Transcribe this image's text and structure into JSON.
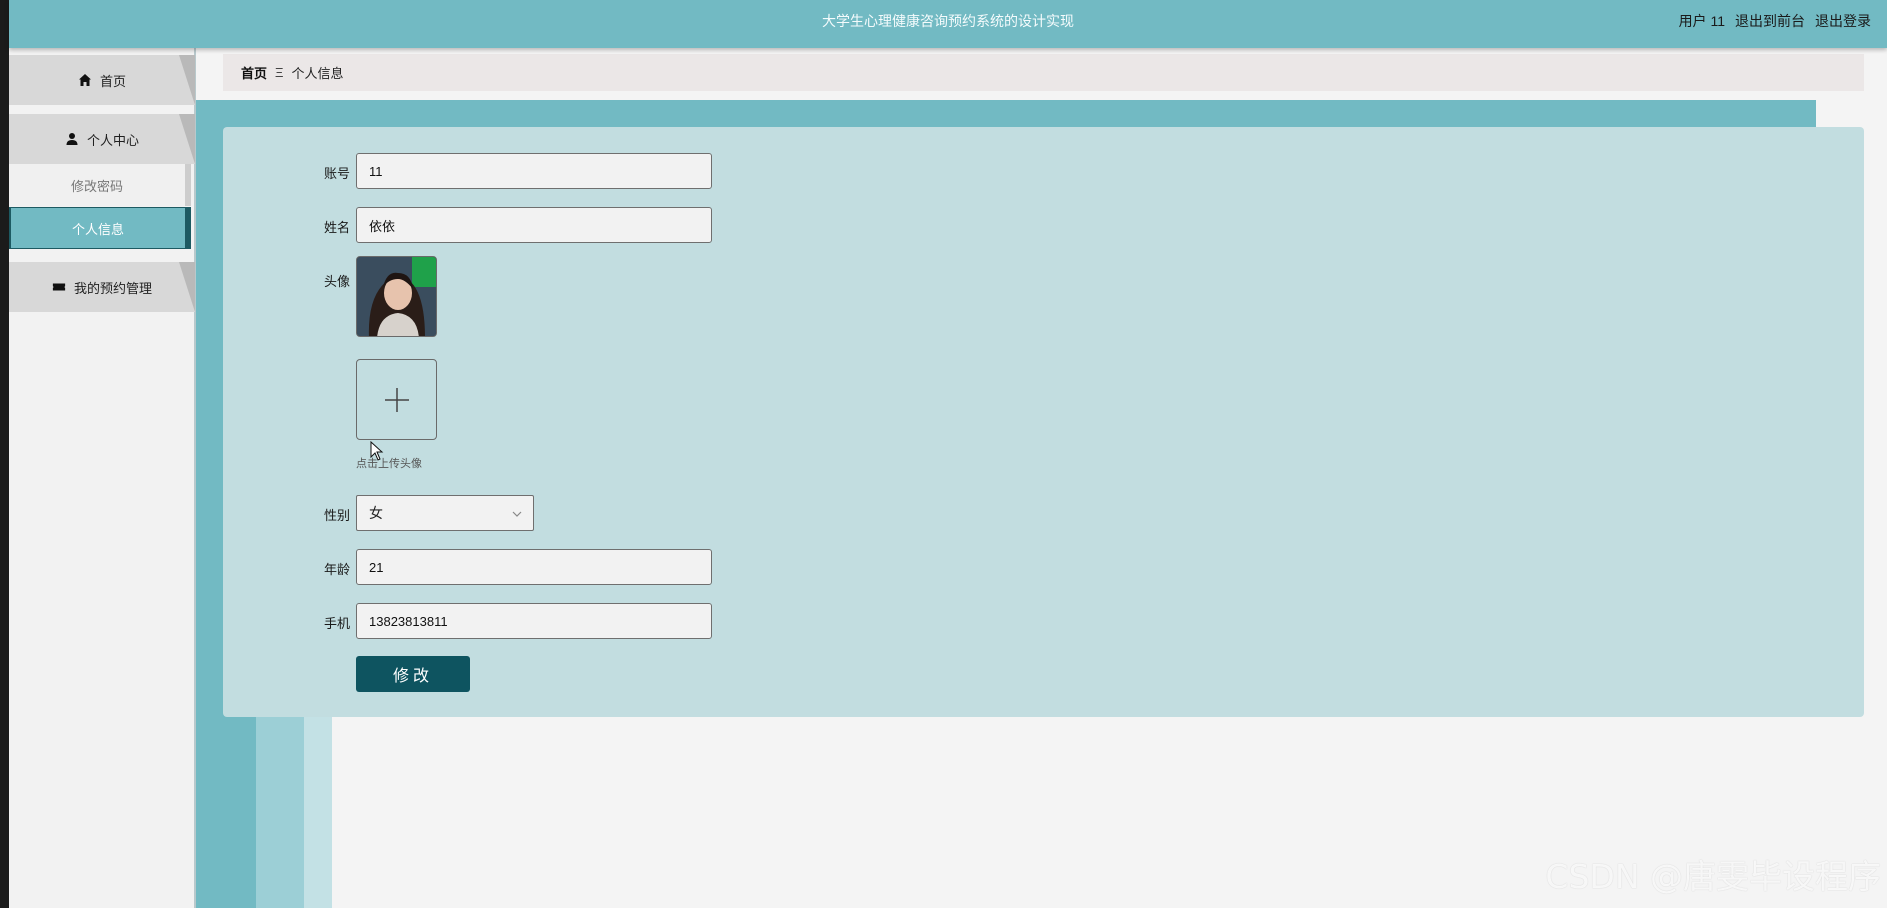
{
  "header": {
    "title": "大学生心理健康咨询预约系统的设计实现",
    "user": "用户 11",
    "to_front": "退出到前台",
    "logout": "退出登录"
  },
  "sidebar": {
    "items": [
      {
        "label": "首页",
        "icon": "home-icon"
      },
      {
        "label": "个人中心",
        "icon": "user-icon"
      },
      {
        "label": "我的预约管理",
        "icon": "ticket-icon"
      }
    ],
    "sub_items": [
      {
        "label": "修改密码"
      },
      {
        "label": "个人信息"
      }
    ]
  },
  "breadcrumb": {
    "home": "首页",
    "separator": "Ξ",
    "current": "个人信息"
  },
  "form": {
    "account_label": "账号",
    "account_value": "11",
    "name_label": "姓名",
    "name_value": "依依",
    "avatar_label": "头像",
    "upload_hint": "点击上传头像",
    "gender_label": "性别",
    "gender_value": "女",
    "age_label": "年龄",
    "age_value": "21",
    "phone_label": "手机",
    "phone_value": "13823813811",
    "submit_label": "修改"
  },
  "watermark": "CSDN @唐雯毕设程序",
  "colors": {
    "header": "#72bac3",
    "panel": "#c2dde0",
    "active_menu": "#72bac3",
    "button": "#0e5460"
  }
}
